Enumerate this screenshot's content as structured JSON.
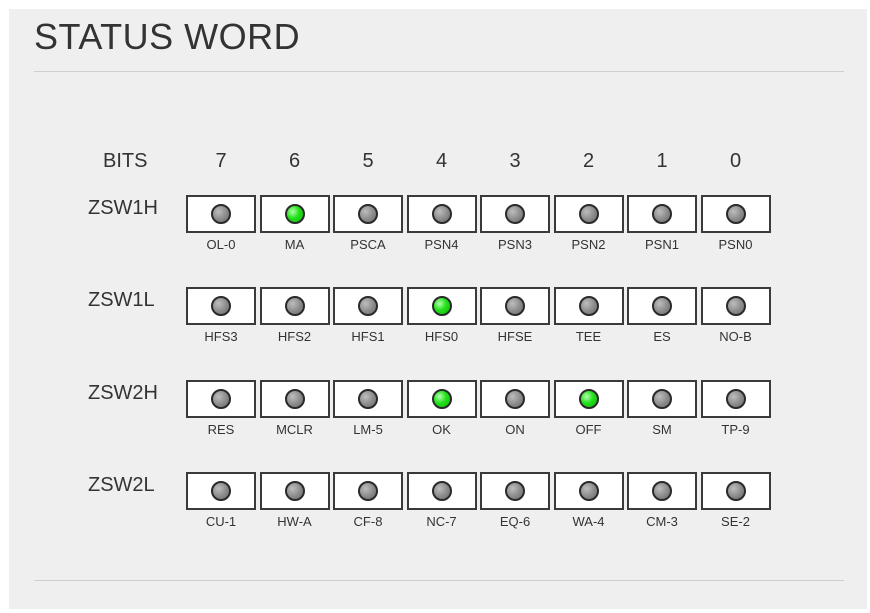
{
  "title": "STATUS WORD",
  "bits_label": "BITS",
  "bit_numbers": [
    "7",
    "6",
    "5",
    "4",
    "3",
    "2",
    "1",
    "0"
  ],
  "rows": [
    {
      "name": "ZSW1H",
      "labels": [
        "OL-0",
        "MA",
        "PSCA",
        "PSN4",
        "PSN3",
        "PSN2",
        "PSN1",
        "PSN0"
      ],
      "states": [
        0,
        1,
        0,
        0,
        0,
        0,
        0,
        0
      ]
    },
    {
      "name": "ZSW1L",
      "labels": [
        "HFS3",
        "HFS2",
        "HFS1",
        "HFS0",
        "HFSE",
        "TEE",
        "ES",
        "NO-B"
      ],
      "states": [
        0,
        0,
        0,
        1,
        0,
        0,
        0,
        0
      ]
    },
    {
      "name": "ZSW2H",
      "labels": [
        "RES",
        "MCLR",
        "LM-5",
        "OK",
        "ON",
        "OFF",
        "SM",
        "TP-9"
      ],
      "states": [
        0,
        0,
        0,
        1,
        0,
        1,
        0,
        0
      ]
    },
    {
      "name": "ZSW2L",
      "labels": [
        "CU-1",
        "HW-A",
        "CF-8",
        "NC-7",
        "EQ-6",
        "WA-4",
        "CM-3",
        "SE-2"
      ],
      "states": [
        0,
        0,
        0,
        0,
        0,
        0,
        0,
        0
      ]
    }
  ],
  "colors": {
    "led_on": "#22e11a",
    "led_off": "#8a8a8a",
    "panel_bg": "#efefef"
  }
}
